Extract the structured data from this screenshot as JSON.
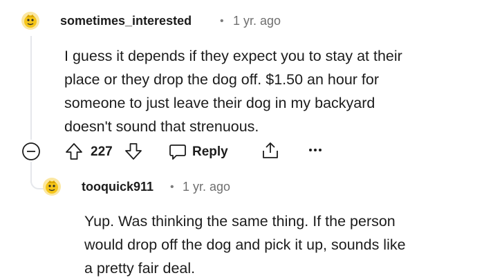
{
  "comment": {
    "username": "sometimes_interested",
    "separator": "•",
    "timestamp": "1 yr. ago",
    "lines": [
      "I guess it depends if they expect you to stay at their",
      "place or they drop the dog off. $1.50 an hour for",
      "someone to just leave their dog in my backyard",
      "doesn't sound that strenuous."
    ],
    "vote_count": "227",
    "reply_label": "Reply"
  },
  "reply": {
    "username": "tooquick911",
    "separator": "•",
    "timestamp": "1 yr. ago",
    "lines": [
      "Yup. Was thinking the same thing. If the person",
      "would drop off the dog and pick it up, sounds like",
      "a pretty fair deal."
    ]
  },
  "icons": {
    "collapse": "collapse-icon",
    "upvote": "upvote-icon",
    "downvote": "downvote-icon",
    "reply": "reply-icon",
    "share": "share-icon",
    "more": "more-icon",
    "avatar": "avatar-icon"
  },
  "colors": {
    "avatar": "#f5c518",
    "thread_line": "#e5e7eb",
    "meta": "#6f6f6f"
  }
}
